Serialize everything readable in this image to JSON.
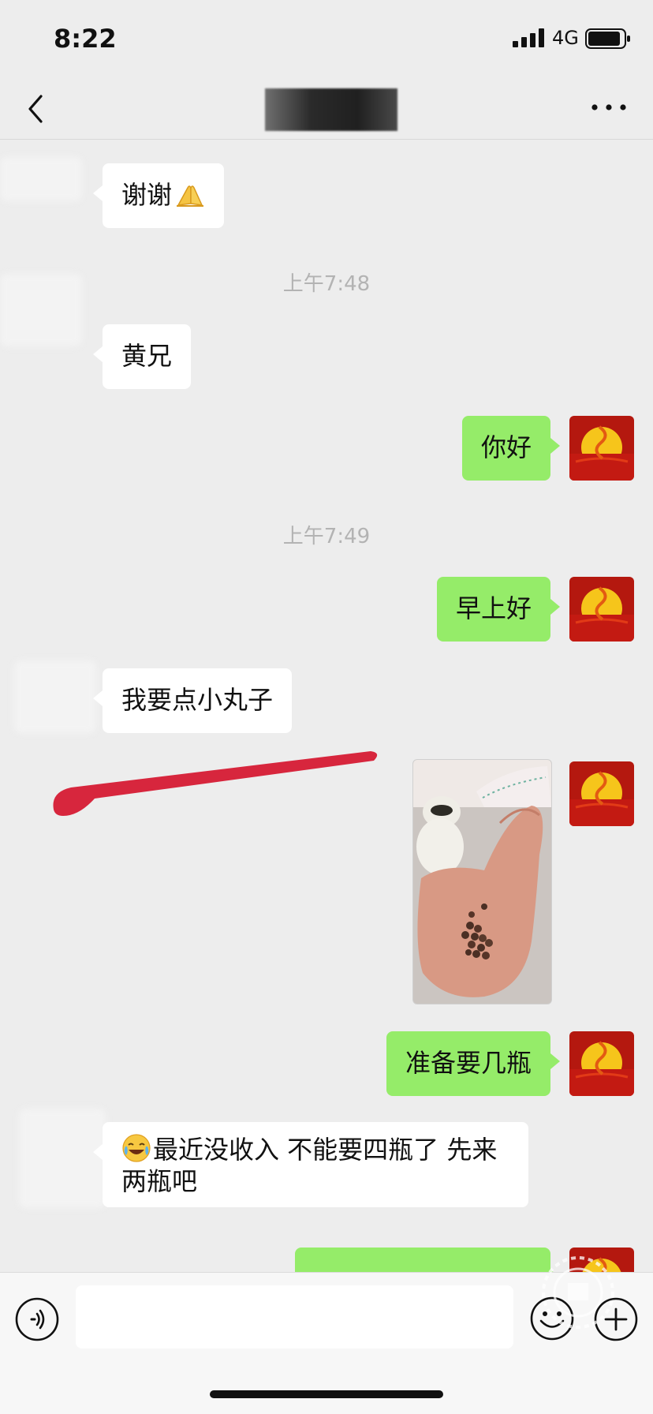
{
  "status_bar": {
    "time": "8:22",
    "network": "4G"
  },
  "nav": {
    "contact_name": "",
    "back_icon": "chevron-left-icon",
    "more_icon": "ellipsis-icon"
  },
  "messages": [
    {
      "type": "text",
      "side": "in",
      "text": "谢谢",
      "emoji": "folded-hands"
    },
    {
      "type": "time",
      "text": "上午7:48"
    },
    {
      "type": "text",
      "side": "in",
      "text": "黄兄"
    },
    {
      "type": "text",
      "side": "out",
      "text": "你好"
    },
    {
      "type": "time",
      "text": "上午7:49"
    },
    {
      "type": "text",
      "side": "out",
      "text": "早上好"
    },
    {
      "type": "text",
      "side": "in",
      "text": "我要点小丸子"
    },
    {
      "type": "image",
      "side": "out",
      "description_icon": "photo-pills-in-hand"
    },
    {
      "type": "text",
      "side": "out",
      "text": "准备要几瓶"
    },
    {
      "type": "text",
      "side": "in",
      "text": "最近没收入  不能要四瓶了  先来两瓶吧",
      "emoji": "face-with-tears-of-joy"
    },
    {
      "type": "text",
      "side": "out",
      "text": ""
    }
  ],
  "colors": {
    "background": "#ededed",
    "bubble_out": "#95ec69",
    "bubble_in": "#ffffff",
    "timestamp": "#b3b3b3",
    "annotation_red": "#d7263d"
  },
  "input_bar": {
    "placeholder": "",
    "voice_icon": "voice-icon",
    "emoji_icon": "smiley-icon",
    "plus_icon": "plus-circle-icon"
  }
}
